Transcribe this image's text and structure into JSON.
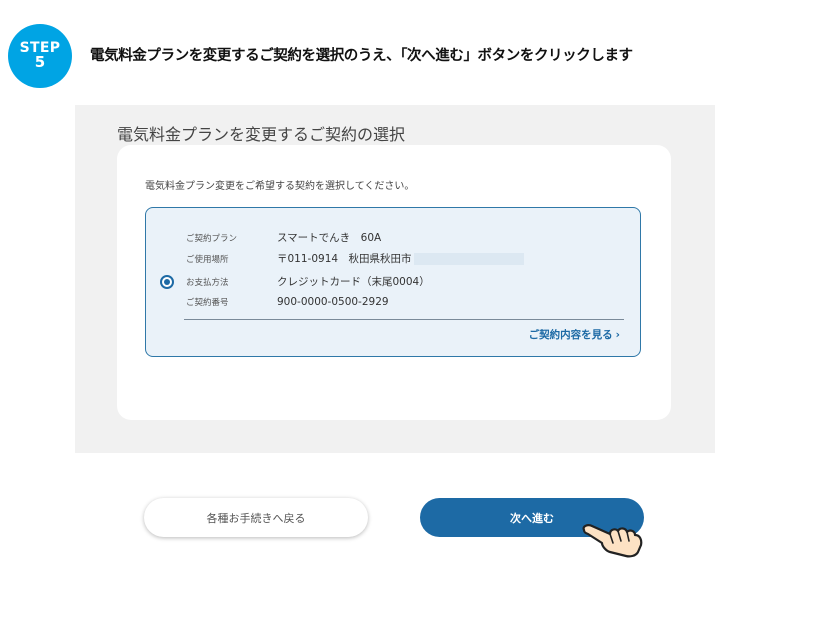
{
  "step": {
    "label": "STEP",
    "number": "5"
  },
  "instruction": "電気料金プランを変更するご契約を選択のうえ、「次へ進む」ボタンをクリックします",
  "screen": {
    "title": "電気料金プランを変更するご契約の選択",
    "card": {
      "instruction": "電気料金プラン変更をご希望する契約を選択してください。",
      "contract": {
        "selected": true,
        "rows": [
          {
            "label": "ご契約プラン",
            "value": "スマートでんき　60A"
          },
          {
            "label": "ご使用場所",
            "value": "〒011-0914　秋田県秋田市"
          },
          {
            "label": "お支払方法",
            "value": "クレジットカード（末尾0004）"
          },
          {
            "label": "ご契約番号",
            "value": "900-0000-0500-2929"
          }
        ],
        "detail_link": "ご契約内容を見る"
      }
    }
  },
  "buttons": {
    "back": "各種お手続きへ戻る",
    "next": "次へ進む"
  },
  "colors": {
    "step_badge": "#00a4e4",
    "primary": "#1d6aa5",
    "screen_bg": "#f1f1f1",
    "option_bg": "#eaf2f9"
  },
  "icons": {
    "radio": "radio-selected-icon",
    "chevron": "chevron-right-icon",
    "pointer": "pointing-hand-icon"
  }
}
